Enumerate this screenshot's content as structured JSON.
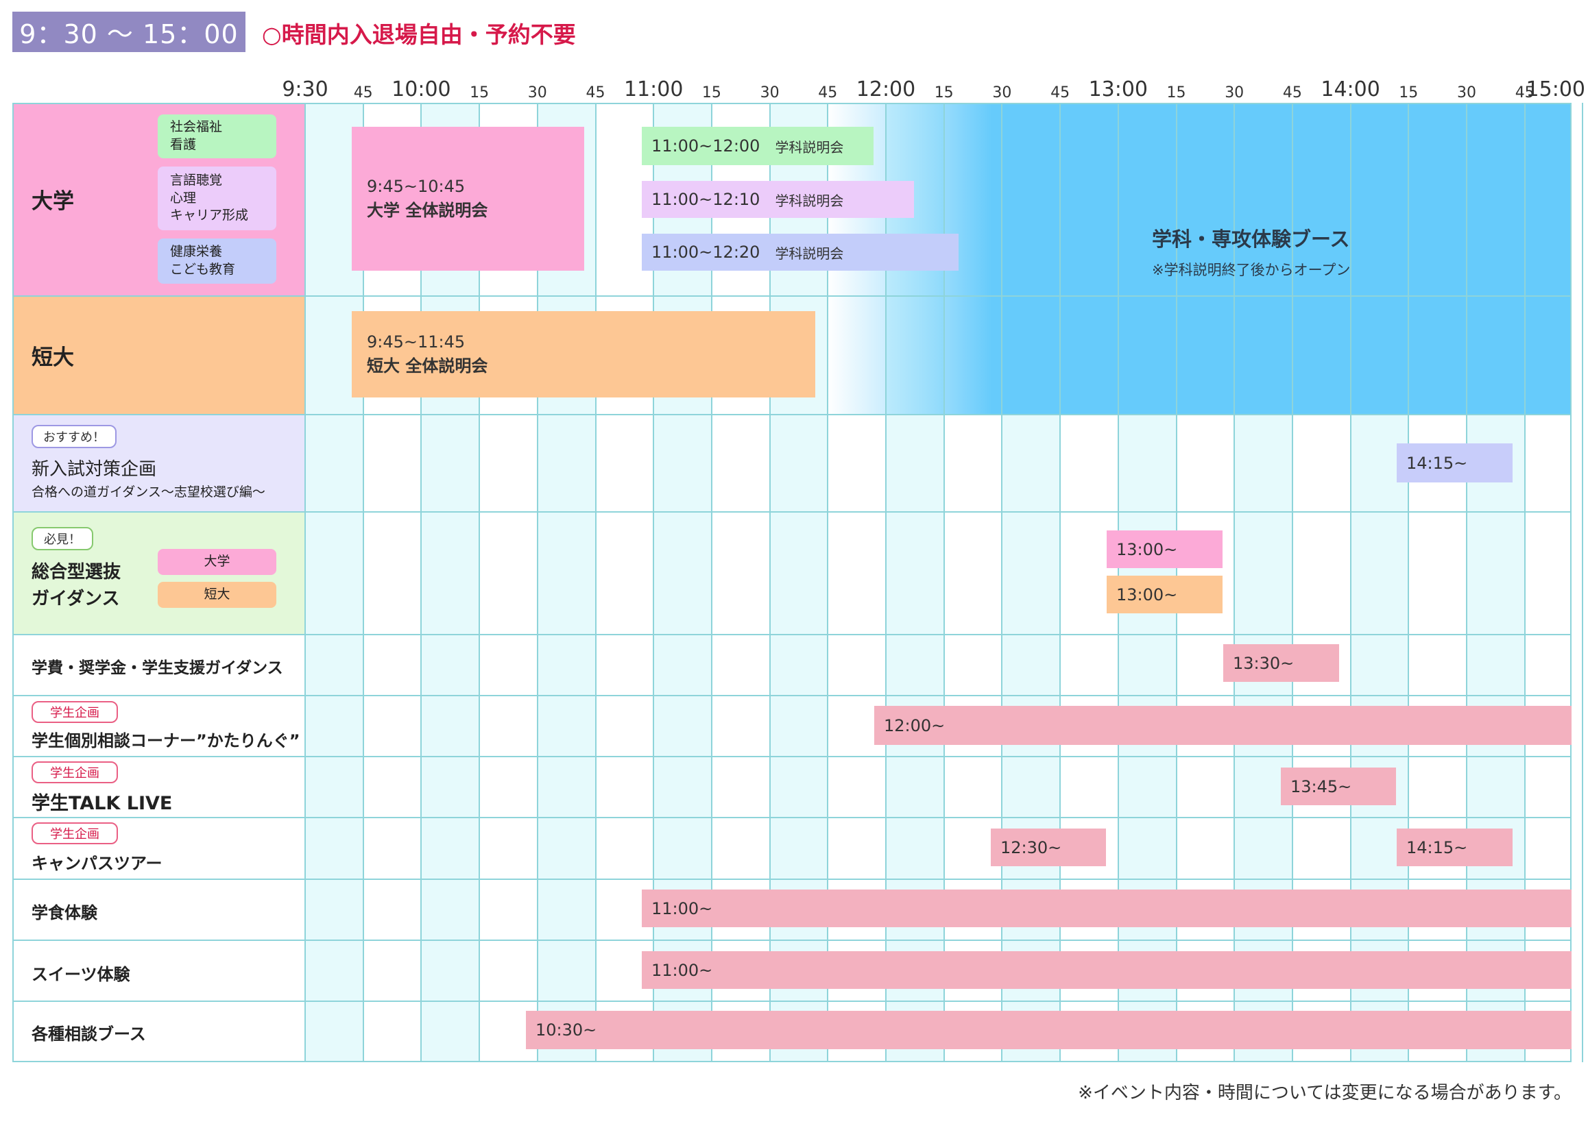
{
  "header": {
    "time_range": "9：30 〜 15：00",
    "note": "○時間内入退場自由・予約不要"
  },
  "time_axis": [
    "9:30",
    "45",
    "10:00",
    "15",
    "30",
    "45",
    "11:00",
    "15",
    "30",
    "45",
    "12:00",
    "15",
    "30",
    "45",
    "13:00",
    "15",
    "30",
    "45",
    "14:00",
    "15",
    "30",
    "45",
    "15:00"
  ],
  "rows": {
    "daigaku": {
      "label": "大学",
      "pills": [
        {
          "lines": [
            "社会福祉",
            "看護"
          ],
          "color": "#b8f5c1"
        },
        {
          "lines": [
            "言語聴覚",
            "心理",
            "キャリア形成"
          ],
          "color": "#ecccfa"
        },
        {
          "lines": [
            "健康栄養",
            "こども教育"
          ],
          "color": "#c3cdfa"
        }
      ]
    },
    "tandai": {
      "label": "短大"
    },
    "nyushi": {
      "tag": "おすすめ！",
      "title": "新入試対策企画",
      "subtitle": "合格への道ガイダンス〜志望校選び編〜"
    },
    "sogo": {
      "tag": "必見！",
      "title_line1": "総合型選抜",
      "title_line2": "ガイダンス",
      "pill_daigaku": "大学",
      "pill_tandai": "短大"
    },
    "gakuhi": {
      "label": "学費・奨学金・学生支援ガイダンス"
    },
    "katarin": {
      "tag": "学生企画",
      "label": "学生個別相談コーナー”かたりんぐ”"
    },
    "talk": {
      "tag": "学生企画",
      "label": "学生TALK LIVE"
    },
    "campus": {
      "tag": "学生企画",
      "label": "キャンパスツアー"
    },
    "gakushoku": {
      "label": "学食体験"
    },
    "sweets": {
      "label": "スイーツ体験"
    },
    "soudan": {
      "label": "各種相談ブース"
    }
  },
  "events": {
    "daigaku_overall": {
      "time": "9:45~10:45",
      "title": "大学 全体説明会"
    },
    "gakka1": {
      "time": "11:00~12:00",
      "title": "学科説明会"
    },
    "gakka2": {
      "time": "11:00~12:10",
      "title": "学科説明会"
    },
    "gakka3": {
      "time": "11:00~12:20",
      "title": "学科説明会"
    },
    "booth": {
      "title": "学科・専攻体験ブース",
      "note": "※学科説明終了後からオープン"
    },
    "tandai_overall": {
      "time": "9:45~11:45",
      "title": "短大 全体説明会"
    },
    "nyushi": "14:15~",
    "sogo_daigaku": "13:00~",
    "sogo_tandai": "13:00~",
    "gakuhi": "13:30~",
    "katarin": "12:00~",
    "talk": "13:45~",
    "campus1": "12:30~",
    "campus2": "14:15~",
    "gakushoku": "11:00~",
    "sweets": "11:00~",
    "soudan": "10:30~"
  },
  "colors": {
    "daigaku": "#fcaad7",
    "tandai": "#fdc794",
    "nyushi": "#e7e5fc",
    "sogo": "#e3f8d9",
    "slot_alt": "#e6fafc",
    "booth": "#66cbfb",
    "event_pink": "#f3b1bf",
    "event_lavender": "#c8cdfa"
  },
  "footer_note": "※イベント内容・時間については変更になる場合があります。"
}
